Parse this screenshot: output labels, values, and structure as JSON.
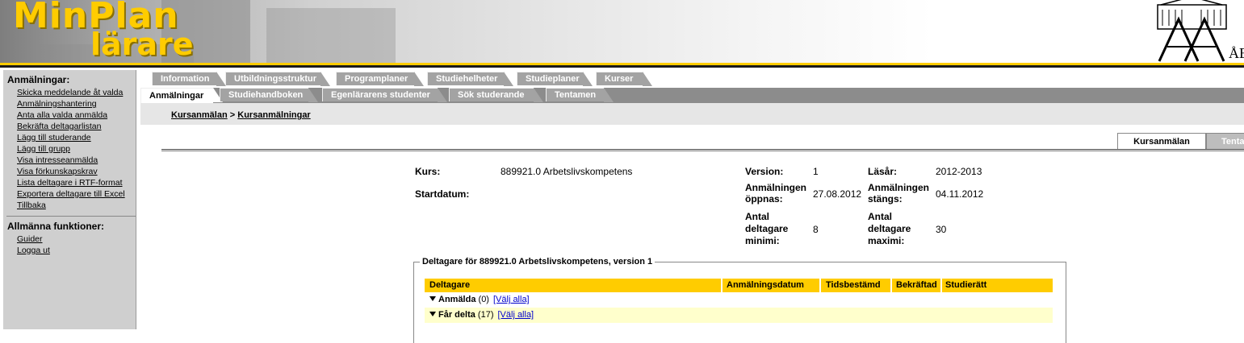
{
  "header": {
    "logo_line1": "MinPlan",
    "logo_line2": "lärare",
    "university_text": "ÅB"
  },
  "left_menu": {
    "section1_title": "Anmälningar:",
    "section1_links": [
      "Skicka meddelande åt valda",
      "Anmälningshantering",
      "Anta alla valda anmälda",
      "Bekräfta deltagarlistan",
      "Lägg till studerande",
      "Lägg till grupp",
      "Visa intresseanmälda",
      "Visa förkunskapskrav",
      "Lista deltagare i RTF-format",
      "Exportera deltagare till Excel",
      "Tillbaka"
    ],
    "section2_title": "Allmänna funktioner:",
    "section2_links": [
      "Guider",
      "Logga ut"
    ]
  },
  "tabs_row1": [
    "Information",
    "Utbildningsstruktur",
    "Programplaner",
    "Studiehelheter",
    "Studieplaner",
    "Kurser"
  ],
  "tabs_row2": [
    "Anmälningar",
    "Studiehandboken",
    "Egenlärarens studenter",
    "Sök studerande",
    "Tentamen"
  ],
  "breadcrumb": {
    "first": "Kursanmälan",
    "separator": " > ",
    "second": "Kursanmälningar"
  },
  "right_tabs": {
    "active": "Kursanmälan",
    "other": "Tenta"
  },
  "info": {
    "kurs_label": "Kurs:",
    "kurs_value": "889921.0 Arbetslivskompetens",
    "startdatum_label": "Startdatum:",
    "version_label": "Version:",
    "version_value": "1",
    "lasar_label": "Läsår:",
    "lasar_value": "2012-2013",
    "oppnas_label_1": "Anmälningen",
    "oppnas_label_2": "öppnas:",
    "oppnas_value": "27.08.2012",
    "stangs_label_1": "Anmälningen",
    "stangs_label_2": "stängs:",
    "stangs_value": "04.11.2012",
    "min_label_1": "Antal",
    "min_label_2": "deltagare",
    "min_label_3": "minimi:",
    "min_value": "8",
    "max_label_1": "Antal",
    "max_label_2": "deltagare",
    "max_label_3": "maximi:",
    "max_value": "30"
  },
  "participants": {
    "legend": "Deltagare för 889921.0 Arbetslivskompetens, version 1",
    "columns": [
      "Deltagare",
      "Anmälningsdatum",
      "Tidsbestämd",
      "Bekräftad",
      "Studierätt"
    ],
    "groups": [
      {
        "name": "Anmälda",
        "count": "(0)",
        "link": "[Välj alla]"
      },
      {
        "name": "Får delta",
        "count": "(17)",
        "link": "[Välj alla]"
      }
    ]
  },
  "colors": {
    "accent_yellow": "#ffcc00",
    "tab_gray": "#a3a3a3",
    "menu_bg": "#cfcfcf",
    "link_blue": "#0000cc"
  }
}
